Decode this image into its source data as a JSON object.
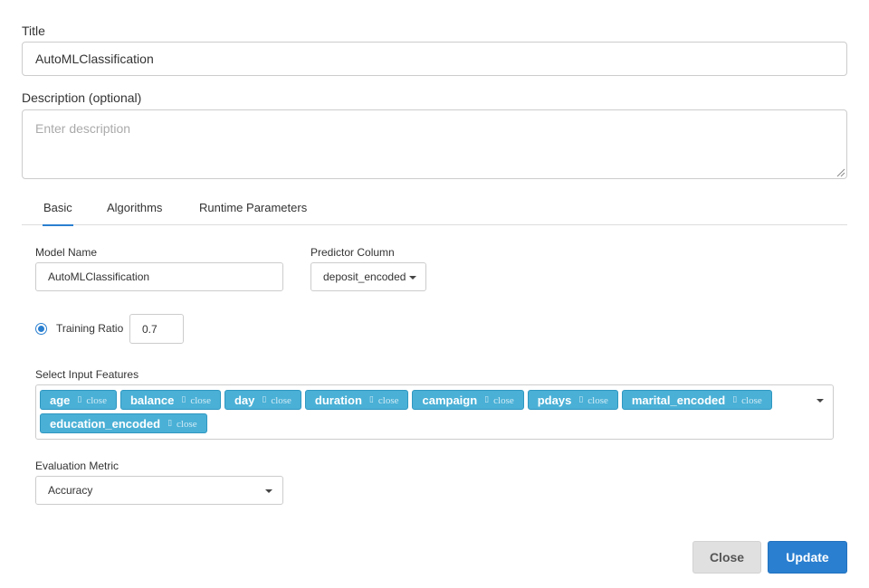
{
  "form": {
    "title_label": "Title",
    "title_value": "AutoMLClassification",
    "description_label": "Description (optional)",
    "description_placeholder": "Enter description"
  },
  "tabs": [
    {
      "label": "Basic",
      "active": true
    },
    {
      "label": "Algorithms",
      "active": false
    },
    {
      "label": "Runtime Parameters",
      "active": false
    }
  ],
  "basic": {
    "model_name_label": "Model Name",
    "model_name_value": "AutoMLClassification",
    "predictor_label": "Predictor Column",
    "predictor_value": "deposit_encoded",
    "training_ratio_label": "Training Ratio",
    "training_ratio_value": "0.7",
    "features_label": "Select Input Features",
    "features": [
      {
        "label": "age",
        "close": "close"
      },
      {
        "label": "balance",
        "close": "close"
      },
      {
        "label": "day",
        "close": "close"
      },
      {
        "label": "duration",
        "close": "close"
      },
      {
        "label": "campaign",
        "close": "close"
      },
      {
        "label": "pdays",
        "close": "close"
      },
      {
        "label": "marital_encoded",
        "close": "close"
      },
      {
        "label": "education_encoded",
        "close": "close"
      }
    ],
    "metric_label": "Evaluation Metric",
    "metric_value": "Accuracy"
  },
  "footer": {
    "close_label": "Close",
    "update_label": "Update"
  },
  "colors": {
    "accent": "#2a7fd0",
    "chip": "#4ab0d6"
  }
}
